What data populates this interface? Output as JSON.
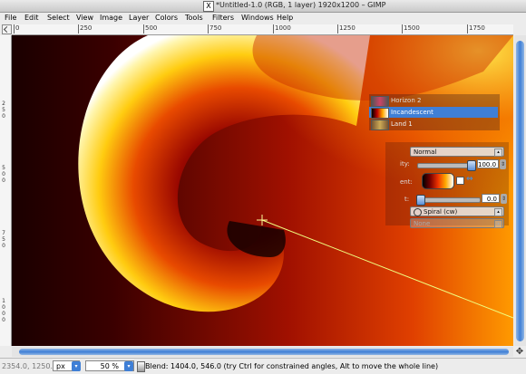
{
  "window": {
    "title": "*Untitled-1.0 (RGB, 1 layer) 1920x1200 – GIMP",
    "xlogo": "X"
  },
  "menu": [
    "File",
    "Edit",
    "Select",
    "View",
    "Image",
    "Layer",
    "Colors",
    "Tools",
    "Filters",
    "Windows",
    "Help"
  ],
  "hruler": [
    "0",
    "250",
    "500",
    "750",
    "1000",
    "1250",
    "1500",
    "1750"
  ],
  "vruler": [
    "2\n5\n0",
    "5\n0\n0",
    "7\n5\n0",
    "1\n0\n0\n0"
  ],
  "gradients": {
    "items": [
      {
        "name": "Horizon 2",
        "selected": false
      },
      {
        "name": "Incandescent",
        "selected": true
      },
      {
        "name": "Land 1",
        "selected": false
      }
    ]
  },
  "tool_options": {
    "mode": "Normal",
    "opacity_label": "ity:",
    "opacity": "100.0",
    "opacity_level": 1.0,
    "gradient_label": "ent:",
    "offset_label": "t:",
    "offset": "0.0",
    "offset_level": 0.0,
    "shape": "Spiral (cw)",
    "repeat": "None"
  },
  "status": {
    "coords": "2354.0, 1250.0",
    "unit": "px",
    "zoom": "50 %",
    "message": "Blend: 1404.0, 546.0 (try Ctrl for constrained angles, Alt to move the whole line)"
  },
  "colors": {
    "selection": "#3f7fd6",
    "accent": "#3f7fd6"
  }
}
